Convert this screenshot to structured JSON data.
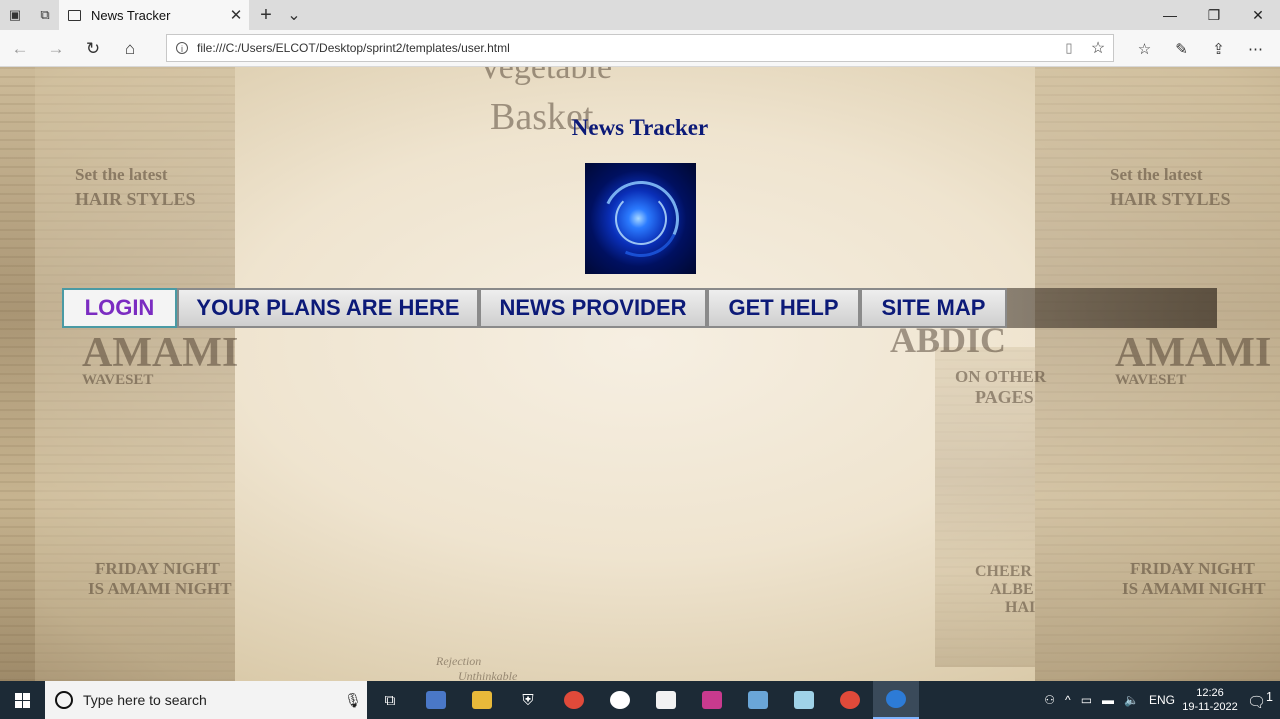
{
  "browser": {
    "tab_title": "News Tracker",
    "url": "file:///C:/Users/ELCOT/Desktop/sprint2/templates/user.html",
    "close_glyph": "✕",
    "new_tab_glyph": "+",
    "tab_list_glyph": "⌄"
  },
  "page": {
    "title": "News Tracker",
    "nav": [
      {
        "label": "LOGIN"
      },
      {
        "label": "YOUR PLANS ARE HERE"
      },
      {
        "label": "NEWS PROVIDER"
      },
      {
        "label": "GET HELP"
      },
      {
        "label": "SITE MAP"
      }
    ],
    "active_nav": "LOGIN",
    "colors": {
      "title": "#0c1a78",
      "nav_text": "#0c1a78",
      "nav_active_text": "#7b2cc1"
    }
  },
  "taskbar": {
    "search_placeholder": "Type here to search",
    "language": "ENG",
    "time": "12:26",
    "date": "19-11-2022",
    "notification_count": "1",
    "apps": [
      "task-view-icon",
      "mail-icon",
      "file-explorer-icon",
      "security-icon",
      "chrome-icon",
      "app-icon",
      "cat-app-icon",
      "intellij-icon",
      "virtualbox-icon",
      "sticky-icon",
      "chrome-icon",
      "edge-icon"
    ]
  },
  "background_text": [
    "Vegetable",
    "Basket",
    "Set the latest",
    "HAIR STYLES",
    "AMAMI",
    "WAVESET",
    "FRIDAY NIGHT",
    "IS AMAMI NIGHT",
    "ON OTHER",
    "PAGES",
    "CHEER",
    "ALBE",
    "HAI",
    "Rejection",
    "Unthinkable",
    "ABDIC"
  ]
}
